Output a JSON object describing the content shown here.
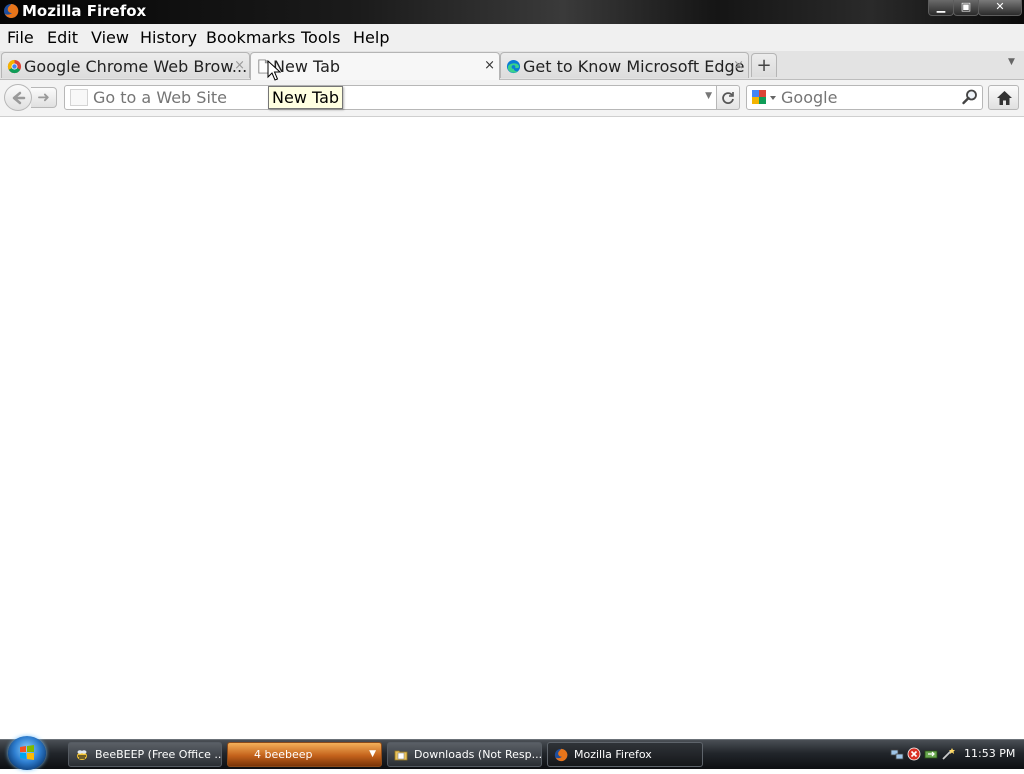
{
  "window": {
    "title": "Mozilla Firefox",
    "minimize_label": "▁",
    "maximize_label": "▣",
    "close_label": "✕"
  },
  "menubar": {
    "items": [
      "File",
      "Edit",
      "View",
      "History",
      "Bookmarks",
      "Tools",
      "Help"
    ]
  },
  "tabs": [
    {
      "label": "Google Chrome Web Brow...",
      "icon": "chrome-icon",
      "active": false
    },
    {
      "label": "New Tab",
      "icon": "page-icon",
      "active": true
    },
    {
      "label": "Get to Know Microsoft Edge",
      "icon": "edge-icon",
      "active": false
    }
  ],
  "tab_close_glyph": "×",
  "new_tab_glyph": "+",
  "navbar": {
    "url_placeholder": "Go to a Web Site",
    "search_placeholder": "Google"
  },
  "tooltip": "New Tab",
  "taskbar": {
    "buttons": [
      {
        "label": "BeeBEEP (Free Office ...",
        "style": "normal"
      },
      {
        "label": "4  beebeep",
        "style": "orange"
      },
      {
        "label": "Downloads (Not Resp...",
        "style": "normal"
      },
      {
        "label": "Mozilla Firefox",
        "style": "active"
      }
    ],
    "clock": "11:53 PM"
  }
}
